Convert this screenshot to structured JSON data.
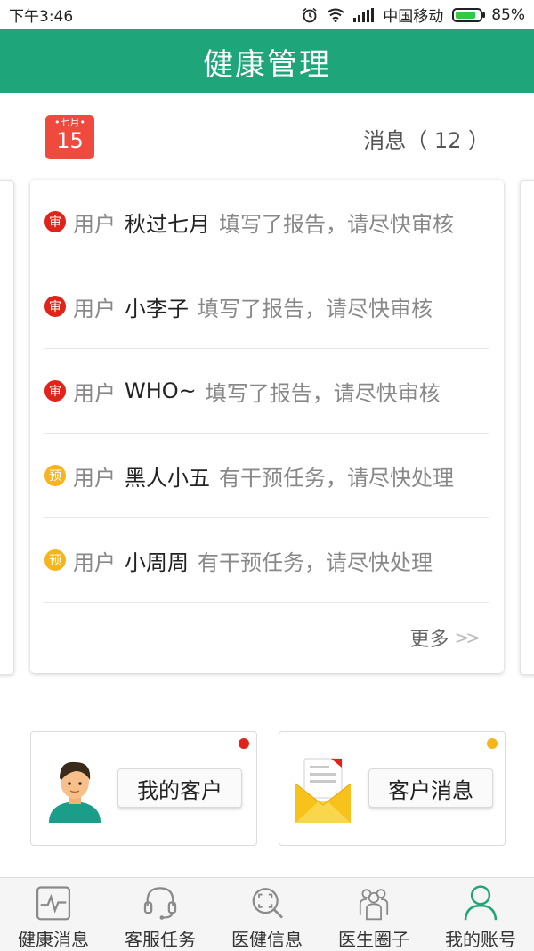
{
  "status_bar": {
    "time": "下午3:46",
    "carrier": "中国移动",
    "battery": "85%",
    "battery_level": 0.85
  },
  "header": {
    "title": "健康管理"
  },
  "calendar": {
    "month": "七月",
    "day": "15"
  },
  "messages": {
    "label": "消息（ 12 ）",
    "items": [
      {
        "badge": "审",
        "badge_color": "#e0241b",
        "prefix": "用户",
        "user": "秋过七月",
        "text": "填写了报告，请尽快审核"
      },
      {
        "badge": "审",
        "badge_color": "#e0241b",
        "prefix": "用户",
        "user": "小李子",
        "text": "填写了报告，请尽快审核"
      },
      {
        "badge": "审",
        "badge_color": "#e0241b",
        "prefix": "用户",
        "user": "WHO~",
        "text": "填写了报告，请尽快审核"
      },
      {
        "badge": "预",
        "badge_color": "#f6b51b",
        "prefix": "用户",
        "user": "黑人小五",
        "text": "有干预任务，请尽快处理"
      },
      {
        "badge": "预",
        "badge_color": "#f6b51b",
        "prefix": "用户",
        "user": "小周周",
        "text": "有干预任务，请尽快处理"
      }
    ],
    "more_label": "更多",
    "more_icon": "double-chevron-right-icon"
  },
  "actions": {
    "my_clients": {
      "label": "我的客户",
      "icon": "user-avatar-icon"
    },
    "client_messages": {
      "label": "客户消息",
      "icon": "mail-envelope-icon"
    }
  },
  "bottom_nav": [
    {
      "label": "健康消息",
      "icon": "heartbeat-icon",
      "active": false
    },
    {
      "label": "客服任务",
      "icon": "headset-icon",
      "active": false
    },
    {
      "label": "医健信息",
      "icon": "scan-search-icon",
      "active": false
    },
    {
      "label": "医生圈子",
      "icon": "group-icon",
      "active": false
    },
    {
      "label": "我的账号",
      "icon": "person-icon",
      "active": true
    }
  ],
  "colors": {
    "primary": "#1fa57a",
    "alert_red": "#e0241b",
    "alert_yellow": "#f6b51b"
  }
}
